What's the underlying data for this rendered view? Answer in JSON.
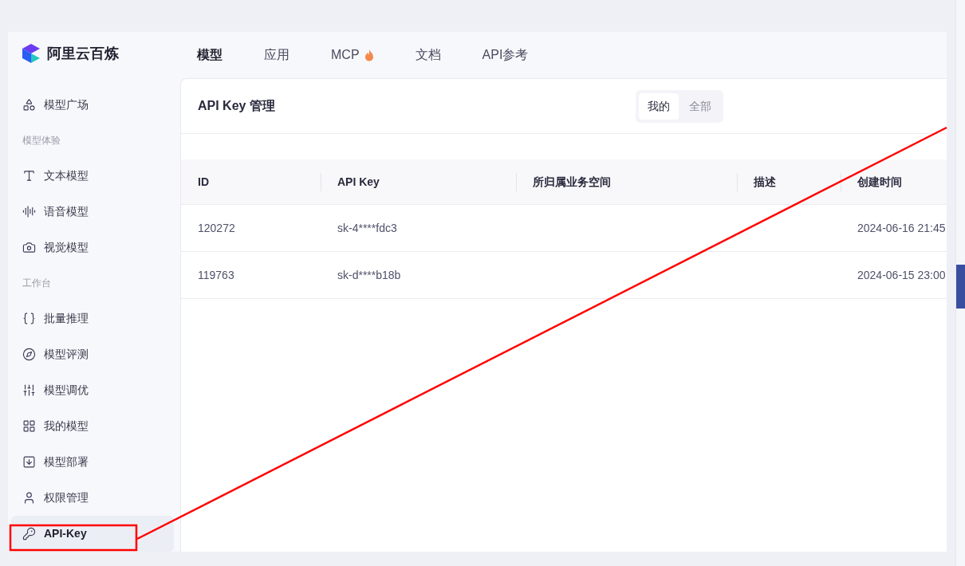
{
  "brand": {
    "name": "阿里云百炼"
  },
  "top_nav": [
    {
      "label": "模型",
      "selected": true,
      "hot": false
    },
    {
      "label": "应用",
      "selected": false,
      "hot": false
    },
    {
      "label": "MCP",
      "selected": false,
      "hot": true
    },
    {
      "label": "文档",
      "selected": false,
      "hot": false
    },
    {
      "label": "API参考",
      "selected": false,
      "hot": false
    }
  ],
  "sidebar": {
    "items": [
      {
        "kind": "item",
        "label": "模型广场",
        "selected": false
      },
      {
        "kind": "heading",
        "label": "模型体验"
      },
      {
        "kind": "item",
        "label": "文本模型",
        "selected": false
      },
      {
        "kind": "item",
        "label": "语音模型",
        "selected": false
      },
      {
        "kind": "item",
        "label": "视觉模型",
        "selected": false
      },
      {
        "kind": "heading",
        "label": "工作台"
      },
      {
        "kind": "item",
        "label": "批量推理",
        "selected": false
      },
      {
        "kind": "item",
        "label": "模型评测",
        "selected": false
      },
      {
        "kind": "item",
        "label": "模型调优",
        "selected": false
      },
      {
        "kind": "item",
        "label": "我的模型",
        "selected": false
      },
      {
        "kind": "item",
        "label": "模型部署",
        "selected": false
      },
      {
        "kind": "item",
        "label": "权限管理",
        "selected": false
      },
      {
        "kind": "item",
        "label": "API-Key",
        "selected": true
      }
    ]
  },
  "panel": {
    "title": "API Key 管理",
    "scope_tabs": [
      {
        "label": "我的",
        "selected": true
      },
      {
        "label": "全部",
        "selected": false
      }
    ],
    "table": {
      "columns": [
        "ID",
        "API Key",
        "所归属业务空间",
        "描述",
        "创建时间"
      ],
      "rows": [
        [
          "120272",
          "sk-4****fdc3",
          "",
          "",
          "2024-06-16 21:45"
        ],
        [
          "119763",
          "sk-d****b18b",
          "",
          "",
          "2024-06-15 23:00"
        ]
      ]
    }
  }
}
